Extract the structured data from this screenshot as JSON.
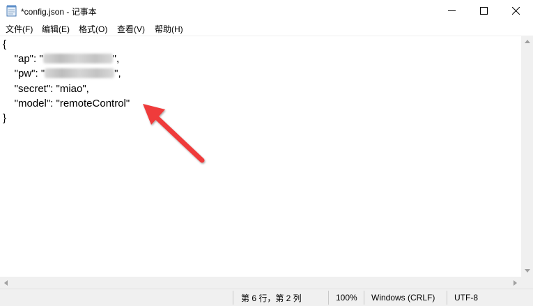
{
  "window": {
    "title": "*config.json - 记事本",
    "controls": {
      "minimize": "minimize-icon",
      "maximize": "maximize-icon",
      "close": "close-icon"
    }
  },
  "menu": {
    "file": "文件(F)",
    "edit": "编辑(E)",
    "format": "格式(O)",
    "view": "查看(V)",
    "help": "帮助(H)"
  },
  "editor": {
    "lines": [
      "{",
      "    \"ap\": \"",
      "    \"pw\": \"",
      "    \"secret\": \"miao\",",
      "    \"model\": \"remoteControl\"",
      "}"
    ],
    "line_suffix": "\","
  },
  "annotation": {
    "arrow_color": "#ef3b3b"
  },
  "statusbar": {
    "position": "第 6 行，第 2 列",
    "zoom": "100%",
    "line_ending": "Windows (CRLF)",
    "encoding": "UTF-8"
  }
}
